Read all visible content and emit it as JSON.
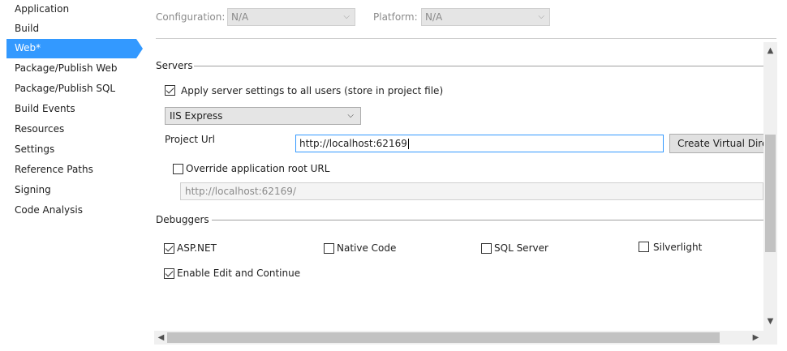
{
  "sidebar": {
    "items": [
      {
        "label": "Application"
      },
      {
        "label": "Build"
      },
      {
        "label": "Web*"
      },
      {
        "label": "Package/Publish Web"
      },
      {
        "label": "Package/Publish SQL"
      },
      {
        "label": "Build Events"
      },
      {
        "label": "Resources"
      },
      {
        "label": "Settings"
      },
      {
        "label": "Reference Paths"
      },
      {
        "label": "Signing"
      },
      {
        "label": "Code Analysis"
      }
    ],
    "active_index": 2
  },
  "config": {
    "configuration_label": "Configuration:",
    "configuration_value": "N/A",
    "platform_label": "Platform:",
    "platform_value": "N/A"
  },
  "servers": {
    "header": "Servers",
    "apply_all_label": "Apply server settings to all users (store in project file)",
    "apply_all_checked": true,
    "server_selected": "IIS Express",
    "project_url_label": "Project Url",
    "project_url_value": "http://localhost:62169",
    "create_vdir_label": "Create Virtual Directory",
    "override_root_label": "Override application root URL",
    "override_root_checked": false,
    "override_root_placeholder": "http://localhost:62169/"
  },
  "debuggers": {
    "header": "Debuggers",
    "aspnet_label": "ASP.NET",
    "aspnet_checked": true,
    "native_label": "Native Code",
    "native_checked": false,
    "sql_label": "SQL Server",
    "sql_checked": false,
    "silverlight_label": "Silverlight",
    "silverlight_checked": false,
    "edit_continue_label": "Enable Edit and Continue",
    "edit_continue_checked": true
  },
  "icons": {
    "chevron": "chevron-down-icon",
    "scroll_up": "scroll-up-icon",
    "scroll_down": "scroll-down-icon",
    "scroll_left": "scroll-left-icon",
    "scroll_right": "scroll-right-icon"
  },
  "colors": {
    "accent": "#3399ff"
  }
}
